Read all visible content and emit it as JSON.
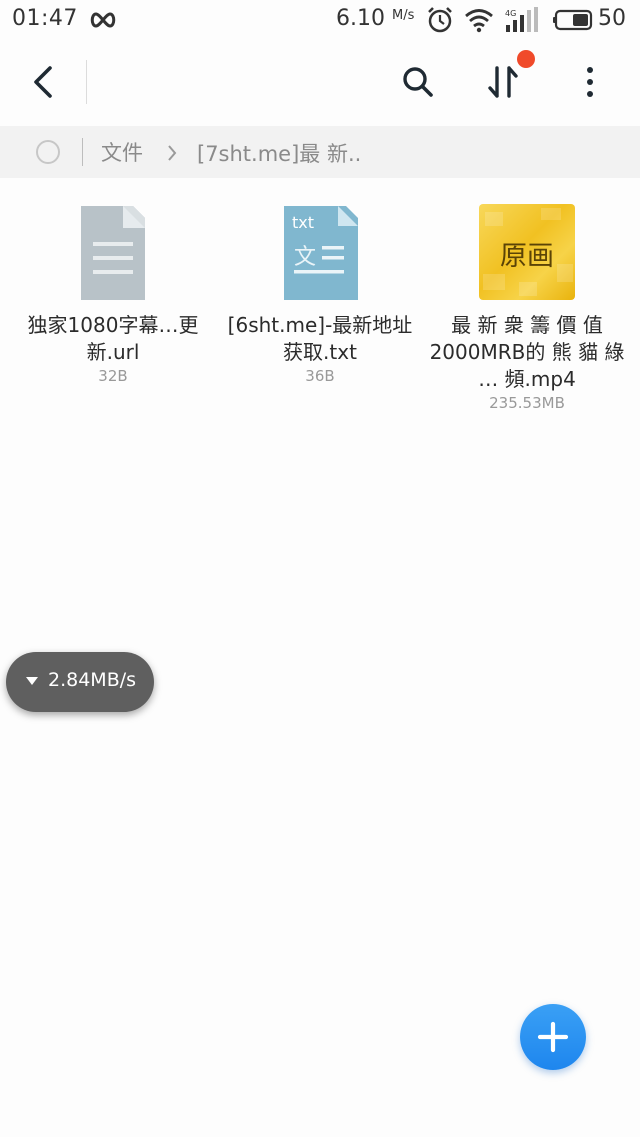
{
  "status_bar": {
    "time": "01:47",
    "net_speed": "6.10",
    "net_speed_unit": "M/s",
    "signal_type": "4G",
    "battery": "50",
    "icons": [
      "infinity-icon",
      "alarm-icon",
      "wifi-icon",
      "signal-icon",
      "battery-icon"
    ]
  },
  "toolbar": {
    "icons": [
      "back-icon",
      "search-icon",
      "sort-icon",
      "more-icon"
    ],
    "sort_badge_color": "#f04a2a"
  },
  "breadcrumb": {
    "root": "文件",
    "current": "[7sht.me]最 新.."
  },
  "files": [
    {
      "name": "独家1080字幕…更新.url",
      "size": "32B",
      "icon": "document-icon"
    },
    {
      "name": "[6sht.me]-最新地址获取.txt",
      "size": "36B",
      "icon": "txt-icon",
      "icon_tag": "txt",
      "icon_char": "文"
    },
    {
      "name": "最 新 衆 籌 價 值 2000MRB的 熊 貓 綠 … 頻.mp4",
      "size": "235.53MB",
      "icon": "video-thumbnail",
      "thumb_label": "原画"
    }
  ],
  "download_speed": "2.84MB/s",
  "colors": {
    "accent": "#1e86ee",
    "txt_icon": "#80b7cf",
    "doc_icon": "#b8c2c8"
  }
}
